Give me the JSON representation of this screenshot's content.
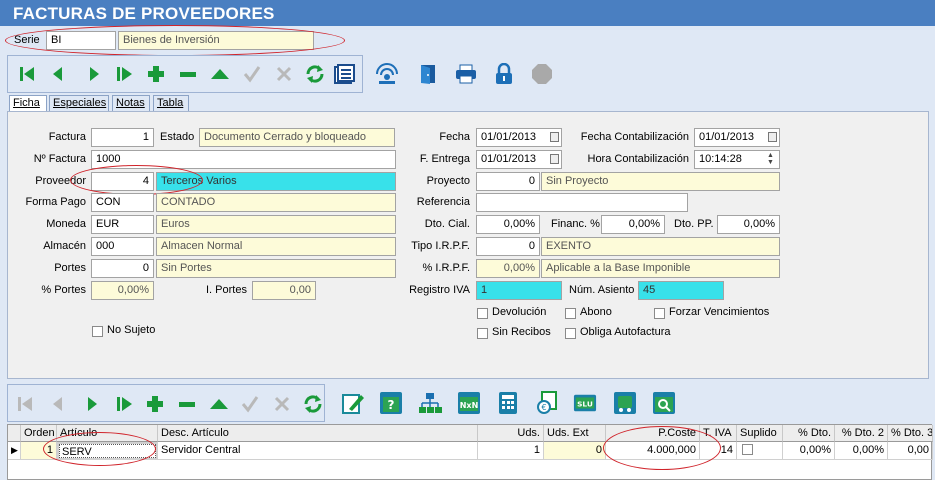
{
  "window": {
    "title": "FACTURAS DE PROVEEDORES"
  },
  "serie": {
    "label": "Serie",
    "code": "BI",
    "description": "Bienes de Inversión"
  },
  "toolbar": {
    "icons": [
      "first-icon",
      "prev-icon",
      "next-icon",
      "last-icon",
      "add-icon",
      "remove-icon",
      "up-icon",
      "check-icon",
      "cancel-icon",
      "refresh-icon",
      "list-icon",
      "signal-icon",
      "exit-door-icon",
      "printer-icon",
      "lock-icon",
      "stop-icon"
    ]
  },
  "tabs": [
    "Ficha",
    "Especiales",
    "Notas",
    "Tabla"
  ],
  "form": {
    "factura": {
      "label": "Factura",
      "value": "1"
    },
    "estado": {
      "label": "Estado",
      "value": "Documento Cerrado y bloqueado"
    },
    "nfactura": {
      "label": "Nº Factura",
      "value": "1000"
    },
    "proveedor": {
      "label": "Proveedor",
      "code": "4",
      "name": "Terceros Varios"
    },
    "forma_pago": {
      "label": "Forma Pago",
      "code": "CON",
      "name": "CONTADO"
    },
    "moneda": {
      "label": "Moneda",
      "code": "EUR",
      "name": "Euros"
    },
    "almacen": {
      "label": "Almacén",
      "code": "000",
      "name": "Almacen Normal"
    },
    "portes": {
      "label": "Portes",
      "code": "0",
      "name": "Sin Portes"
    },
    "pct_portes": {
      "label": "% Portes",
      "value": "0,00%"
    },
    "i_portes": {
      "label": "I. Portes",
      "value": "0,00"
    },
    "no_sujeto": {
      "label": "No Sujeto"
    },
    "fecha": {
      "label": "Fecha",
      "value": "01/01/2013"
    },
    "fecha_contab": {
      "label": "Fecha Contabilización",
      "value": "01/01/2013"
    },
    "f_entrega": {
      "label": "F. Entrega",
      "value": "01/01/2013"
    },
    "hora_contab": {
      "label": "Hora Contabilización",
      "value": "10:14:28"
    },
    "proyecto": {
      "label": "Proyecto",
      "code": "0",
      "name": "Sin Proyecto"
    },
    "referencia": {
      "label": "Referencia",
      "value": ""
    },
    "dto_cial": {
      "label": "Dto. Cial.",
      "value": "0,00%"
    },
    "financ": {
      "label": "Financ. %",
      "value": "0,00%"
    },
    "dto_pp": {
      "label": "Dto. PP.",
      "value": "0,00%"
    },
    "tipo_irpf": {
      "label": "Tipo I.R.P.F.",
      "code": "0",
      "name": "EXENTO"
    },
    "pct_irpf": {
      "label": "% I.R.P.F.",
      "value": "0,00%",
      "name": "Aplicable a la Base Imponible"
    },
    "registro_iva": {
      "label": "Registro IVA",
      "value": "1"
    },
    "num_asiento": {
      "label": "Núm. Asiento",
      "value": "45"
    },
    "checks": {
      "devolucion": "Devolución",
      "abono": "Abono",
      "forzar": "Forzar Vencimientos",
      "sin_recibos": "Sin Recibos",
      "obliga": "Obliga Autofactura"
    }
  },
  "grid": {
    "headers": [
      "Orden",
      "Artículo",
      "Desc. Artículo",
      "Uds.",
      "Uds. Ext",
      "P.Coste",
      "T. IVA",
      "Suplido",
      "% Dto.",
      "% Dto. 2",
      "% Dto. 3"
    ],
    "row": {
      "orden": "1",
      "articulo": "SERV",
      "desc": "Servidor Central",
      "uds": "1",
      "uds_ext": "0",
      "pcoste": "4.000,000",
      "tiva": "14",
      "dto": "0,00%",
      "dto2": "0,00%",
      "dto3": "0,00"
    }
  },
  "colors": {
    "title_bar": "#4a7fc1",
    "highlight_field": "#38e1ea",
    "readonly_field": "#fdfbd9",
    "icon_green": "#1a9a3a",
    "annotation": "#d0242b"
  }
}
